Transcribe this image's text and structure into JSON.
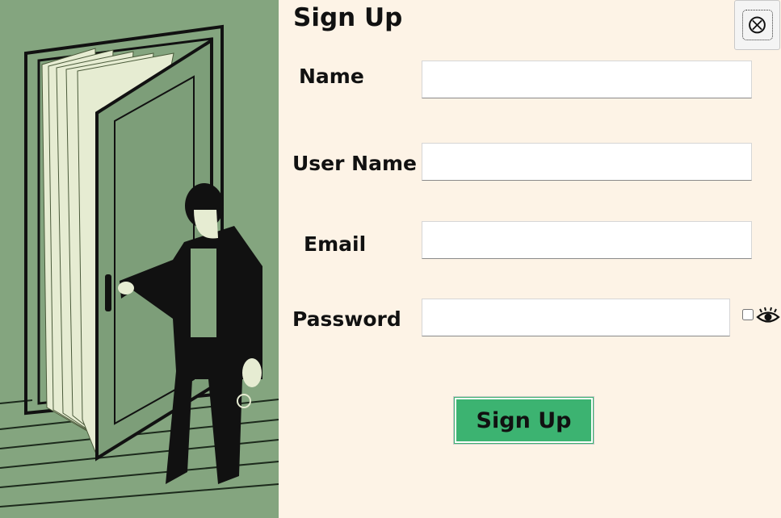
{
  "form": {
    "title": "Sign Up",
    "fields": {
      "name": {
        "label": "Name",
        "value": ""
      },
      "username": {
        "label": "User Name",
        "value": ""
      },
      "email": {
        "label": "Email",
        "value": ""
      },
      "password": {
        "label": "Password",
        "value": ""
      }
    },
    "submit_label": "Sign Up",
    "close_icon": "close-icon",
    "show_password_icon": "eye-icon"
  },
  "colors": {
    "panel_background": "#fdf3e6",
    "submit_button": "#3cb371",
    "illustration_background": "#84a57f"
  }
}
